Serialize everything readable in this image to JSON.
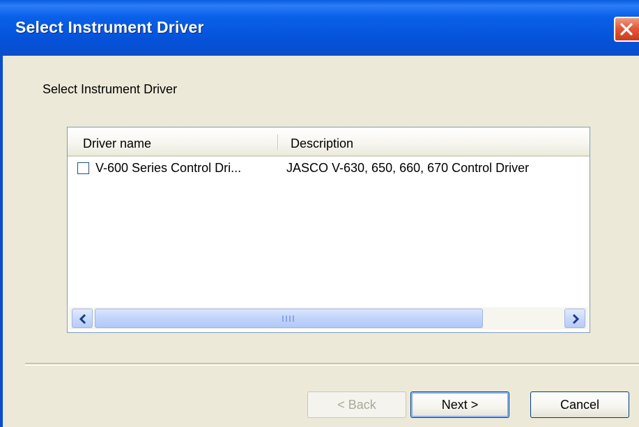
{
  "window": {
    "title": "Select Instrument Driver",
    "close_icon": "close-icon",
    "title_color": "#0a5de0",
    "close_color": "#e2593a"
  },
  "dialog": {
    "heading": "Select Instrument Driver"
  },
  "driver_list": {
    "columns": [
      "Driver name",
      "Description"
    ],
    "rows": [
      {
        "checked": false,
        "name": "V-600 Series Control Dri...",
        "description": "JASCO V-630, 650, 660, 670 Control Driver"
      }
    ]
  },
  "scrollbar": {
    "left_icon": "chevron-left-icon",
    "right_icon": "chevron-right-icon",
    "grip_icon": "grip-icon"
  },
  "buttons": {
    "back": "< Back",
    "next": "Next >",
    "cancel": "Cancel"
  }
}
